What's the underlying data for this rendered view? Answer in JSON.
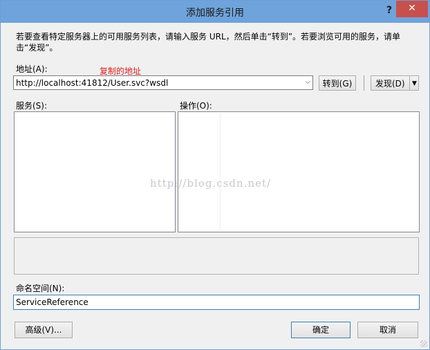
{
  "window": {
    "title": "添加服务引用",
    "help_label": "?",
    "close_label": "✕"
  },
  "description": "若要查看特定服务器上的可用服务列表，请输入服务 URL，然后单击“转到”。若要浏览可用的服务，请单击“发现”。",
  "address": {
    "label": "地址(A):",
    "note": "复制的地址",
    "value": "http://localhost:41812/User.svc?wsdl",
    "go_button": "转到(G)",
    "discover_button": "发现(D)"
  },
  "services": {
    "label": "服务(S):"
  },
  "operations": {
    "label": "操作(O):"
  },
  "namespace": {
    "label": "命名空间(N):",
    "value": "ServiceReference"
  },
  "buttons": {
    "advanced": "高级(V)...",
    "ok": "确定",
    "cancel": "取消"
  },
  "watermark": "http://blog.csdn.net/"
}
